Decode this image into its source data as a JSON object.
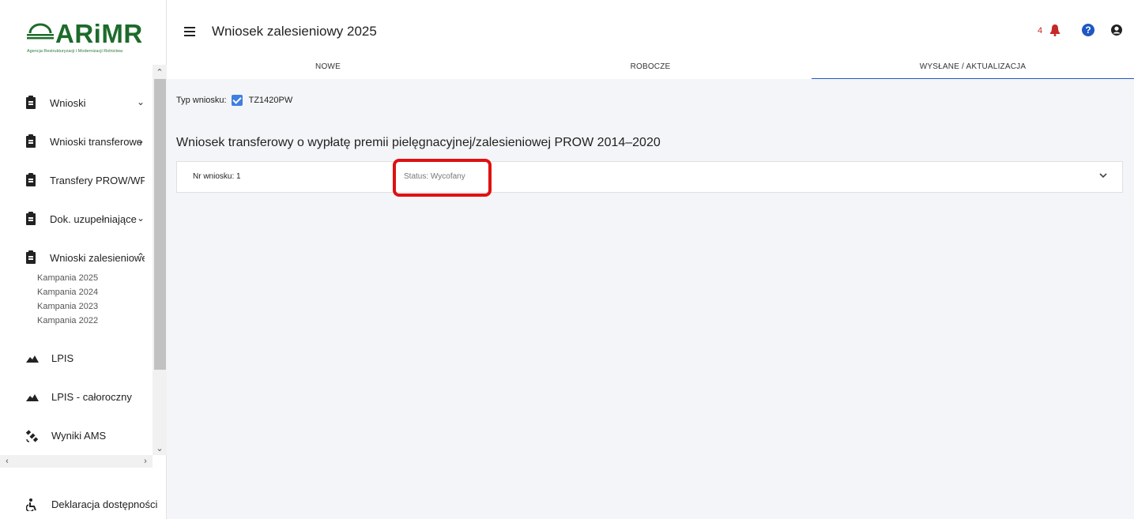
{
  "sidebar": {
    "logo_text": "ARiMR",
    "logo_subtitle": "Agencja Restrukturyzacji i Modernizacji Rolnictwa",
    "items": [
      {
        "label": "Wnioski",
        "icon": "clipboard-icon",
        "chevron": "⌄"
      },
      {
        "label": "Wnioski transferowe",
        "icon": "clipboard-icon",
        "chevron": "⌄"
      },
      {
        "label": "Transfery PROW/WPR",
        "icon": "clipboard-icon",
        "chevron": ""
      },
      {
        "label": "Dok. uzupełniające",
        "icon": "clipboard-icon",
        "chevron": "⌄"
      },
      {
        "label": "Wnioski zalesieniowe",
        "icon": "clipboard-icon",
        "chevron": "⌃"
      }
    ],
    "submenu": [
      "Kampania 2025",
      "Kampania 2024",
      "Kampania 2023",
      "Kampania 2022"
    ],
    "items2": [
      {
        "label": "LPIS",
        "icon": "mountain-icon"
      },
      {
        "label": "LPIS - całoroczny",
        "icon": "mountain-icon"
      },
      {
        "label": "Wyniki AMS",
        "icon": "satellite-icon"
      }
    ],
    "accessibility_label": "Deklaracja dostępności"
  },
  "header": {
    "title": "Wniosek zalesieniowy 2025",
    "notification_count": "4"
  },
  "tabs": [
    {
      "label": "NOWE",
      "active": false
    },
    {
      "label": "ROBOCZE",
      "active": false
    },
    {
      "label": "WYSŁANE / AKTUALIZACJA",
      "active": true
    }
  ],
  "main": {
    "type_label": "Typ wniosku:",
    "type_value": "TZ1420PW",
    "section_title": "Wniosek transferowy o wypłatę premii pielęgnacyjnej/zalesieniowej PROW 2014–2020",
    "card": {
      "number_label": "Nr wniosku: 1",
      "status_label": "Status: Wycofany"
    }
  },
  "colors": {
    "accent": "#1f57c3",
    "brand_green": "#1d6b2a",
    "highlight": "#e01010",
    "notification": "#c62828"
  }
}
